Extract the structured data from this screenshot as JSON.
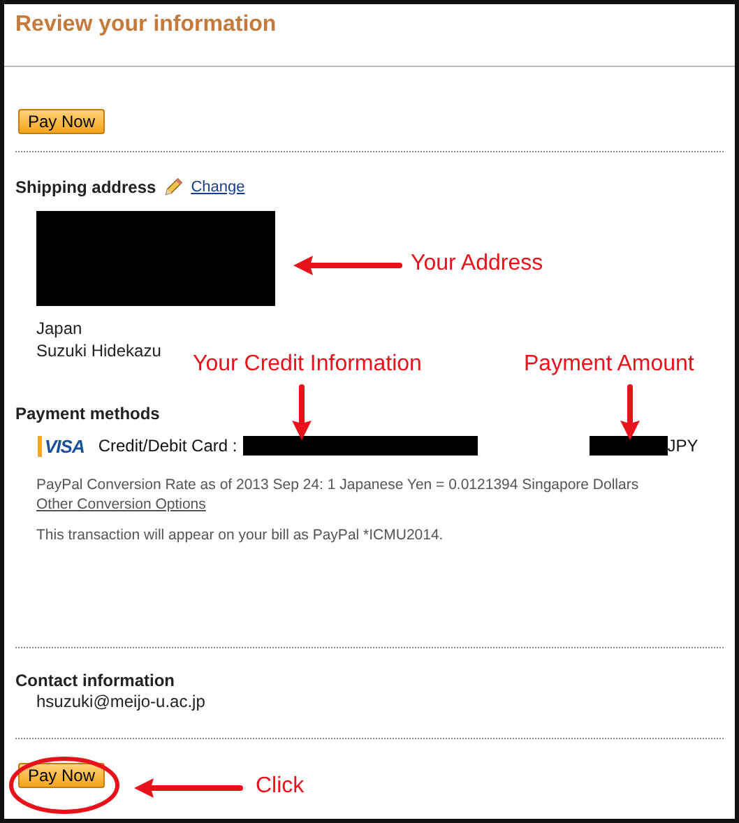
{
  "title": "Review your information",
  "pay_button_top": "Pay Now",
  "shipping": {
    "heading": "Shipping address",
    "change_link": "Change",
    "lines": [
      "Japan",
      "Suzuki Hidekazu"
    ]
  },
  "payment": {
    "heading": "Payment methods",
    "card_label": "Credit/Debit Card :",
    "currency": "JPY",
    "conversion": "PayPal Conversion Rate as of 2013 Sep 24: 1 Japanese Yen = 0.0121394 Singapore Dollars",
    "conversion_link": "Other Conversion Options",
    "statement": "This transaction will appear on your bill as PayPal *ICMU2014."
  },
  "contact": {
    "heading": "Contact information",
    "email": "hsuzuki@meijo-u.ac.jp"
  },
  "pay_button_bottom": "Pay Now",
  "card_brand": "VISA",
  "callouts": [
    {
      "text": "Your Address",
      "kind": "left"
    },
    {
      "text": "Your Credit Information",
      "kind": "down"
    },
    {
      "text": "Payment Amount",
      "kind": "down"
    },
    {
      "text": "Click",
      "kind": "left"
    }
  ]
}
